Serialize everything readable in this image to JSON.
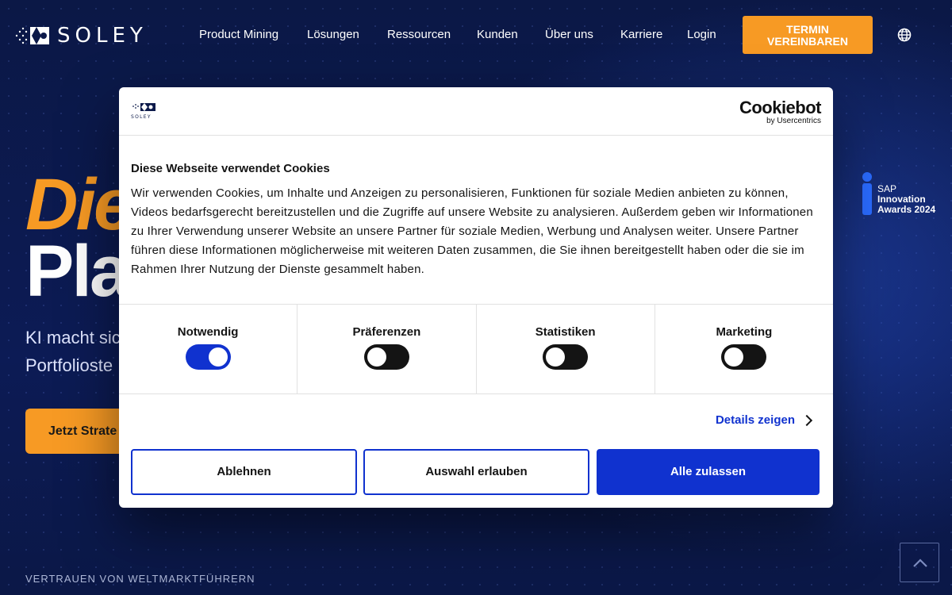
{
  "nav": {
    "logo_text": "SOLEY",
    "items": [
      "Product Mining",
      "Lösungen",
      "Ressourcen",
      "Kunden",
      "Über uns",
      "Karriere",
      "Login"
    ],
    "cta_line1": "TERMIN",
    "cta_line2": "VEREINBAREN",
    "globe_icon": "globe-icon"
  },
  "hero": {
    "word1": "Die",
    "word2": "Pla",
    "line1": "KI macht sic",
    "line2": "Portfolioste",
    "button": "Jetzt Strate",
    "trust": "VERTRAUEN VON WELTMARKTFÜHRERN"
  },
  "award": {
    "line1": "SAP",
    "line2": "Innovation",
    "line3": "Awards 2024"
  },
  "cookie_dialog": {
    "logo_text": "SOLEY",
    "provider": "Cookiebot",
    "provider_sub": "by Usercentrics",
    "title": "Diese Webseite verwendet Cookies",
    "body": "Wir verwenden Cookies, um Inhalte und Anzeigen zu personalisieren, Funktionen für soziale Medien anbieten zu können, Videos bedarfsgerecht bereitzustellen und die Zugriffe auf unsere Website zu analysieren. Außerdem geben wir Informationen zu Ihrer Verwendung unserer Website an unsere Partner für soziale Medien, Werbung und Analysen weiter. Unsere Partner führen diese Informationen möglicherweise mit weiteren Daten zusammen, die Sie ihnen bereitgestellt haben oder die sie im Rahmen Ihrer Nutzung der Dienste gesammelt haben.",
    "categories": [
      {
        "label": "Notwendig",
        "enabled": true
      },
      {
        "label": "Präferenzen",
        "enabled": false
      },
      {
        "label": "Statistiken",
        "enabled": false
      },
      {
        "label": "Marketing",
        "enabled": false
      }
    ],
    "details_link": "Details zeigen",
    "btn_reject": "Ablehnen",
    "btn_allow_selection": "Auswahl erlauben",
    "btn_allow_all": "Alle zulassen"
  },
  "colors": {
    "accent_orange": "#f79a24",
    "cookie_blue": "#1032cf",
    "background_navy": "#0c1a4a"
  }
}
